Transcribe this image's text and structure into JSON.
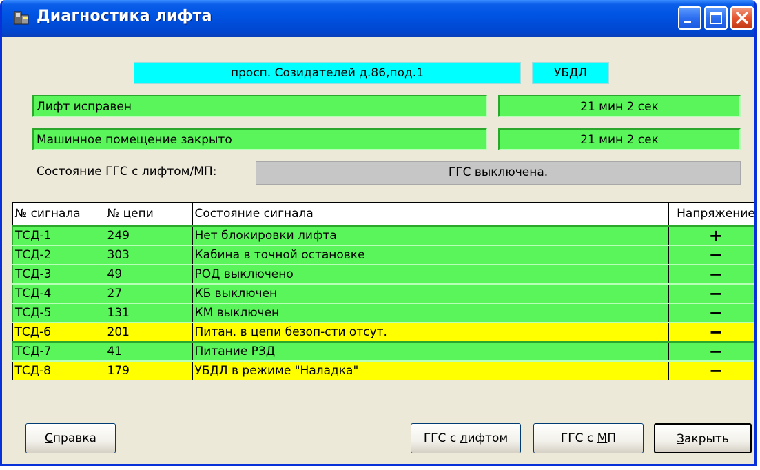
{
  "window": {
    "title": "Диагностика лифта",
    "icon": "elevator-app-icon",
    "controls": [
      "minimize-icon",
      "maximize-icon",
      "close-icon"
    ]
  },
  "info": {
    "address": "просп. Созидателей д.86,под.1",
    "device": "УБДЛ",
    "lift_status": "Лифт исправен",
    "lift_status_time": "21 мин  2 сек",
    "machine_room_status": "Машинное помещение закрыто",
    "machine_room_time": "21 мин  2 сек",
    "ggs_label": "Состояние ГГС с лифтом/МП:",
    "ggs_status": "ГГС выключена."
  },
  "table": {
    "headers": [
      "№ сигнала",
      "№ цепи",
      "Состояние сигнала",
      "Напряжение"
    ],
    "rows": [
      {
        "signal": "ТСД-1",
        "circuit": "249",
        "state": "Нет блокировки лифта",
        "voltage": "+",
        "color": "green"
      },
      {
        "signal": "ТСД-2",
        "circuit": "303",
        "state": "Кабина в точной остановке",
        "voltage": "−",
        "color": "green"
      },
      {
        "signal": "ТСД-3",
        "circuit": "49",
        "state": "РОД выключено",
        "voltage": "−",
        "color": "green"
      },
      {
        "signal": "ТСД-4",
        "circuit": "27",
        "state": "КБ выключен",
        "voltage": "−",
        "color": "green"
      },
      {
        "signal": "ТСД-5",
        "circuit": "131",
        "state": "КМ выключен",
        "voltage": "−",
        "color": "green"
      },
      {
        "signal": "ТСД-6",
        "circuit": "201",
        "state": "Питан. в цепи безоп-сти отсут.",
        "voltage": "−",
        "color": "yellow"
      },
      {
        "signal": "ТСД-7",
        "circuit": "41",
        "state": "Питание РЗД",
        "voltage": "−",
        "color": "green"
      },
      {
        "signal": "ТСД-8",
        "circuit": "179",
        "state": "УБДЛ в режиме \"Наладка\"",
        "voltage": "−",
        "color": "yellow"
      }
    ]
  },
  "buttons": {
    "help": {
      "before": "",
      "u": "С",
      "after": "правка"
    },
    "ggs_lift": {
      "before": "ГГС с ",
      "u": "л",
      "after": "ифтом"
    },
    "ggs_mp": {
      "before": "ГГС с ",
      "u": "М",
      "after": "П"
    },
    "close": {
      "before": "",
      "u": "З",
      "after": "акрыть"
    }
  },
  "colors": {
    "green": "#5AF55A",
    "yellow": "#FFFF00",
    "cyan": "#00FFFF",
    "gray": "#C6C6C6",
    "titlebar": "#0054E3"
  }
}
